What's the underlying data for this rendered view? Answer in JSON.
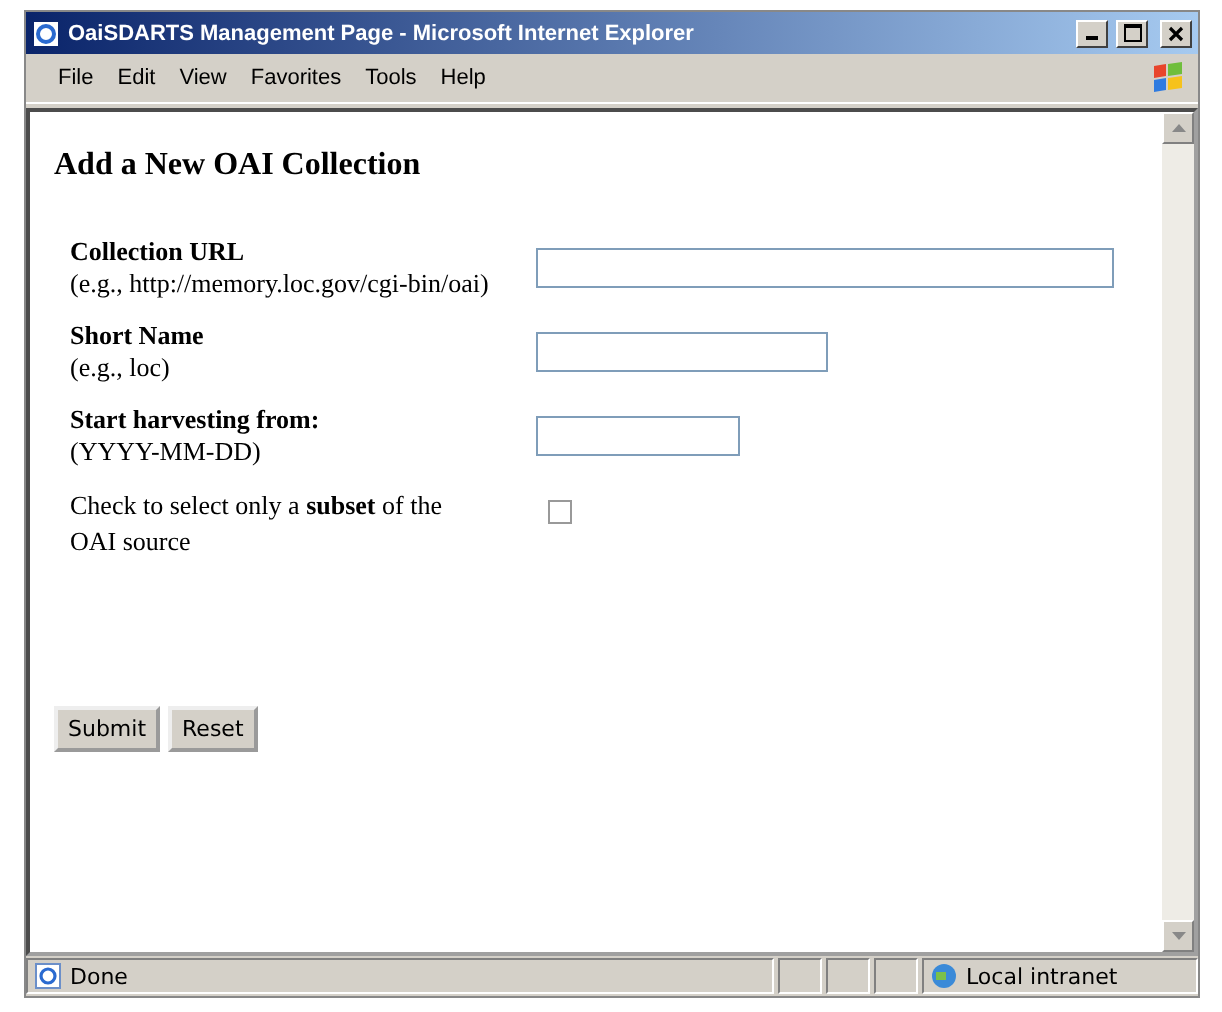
{
  "window": {
    "title": "OaiSDARTS Management Page - Microsoft Internet Explorer"
  },
  "menu": [
    "File",
    "Edit",
    "View",
    "Favorites",
    "Tools",
    "Help"
  ],
  "page": {
    "heading": "Add a New OAI Collection",
    "fields": [
      {
        "kind": "text",
        "label": "Collection URL",
        "hint": " (e.g., http://memory.loc.gov/cgi-bin/oai)"
      },
      {
        "kind": "text",
        "label": "Short Name",
        "hint": "(e.g., loc)"
      },
      {
        "kind": "text",
        "label": "Start harvesting from:",
        "hint": "(YYYY-MM-DD)"
      },
      {
        "kind": "checkbox",
        "label": "Check to select only a **subset** of the OAI source",
        "checked": false
      }
    ],
    "buttons": [
      "Submit",
      "Reset"
    ]
  },
  "status_bar": {
    "text": "Done",
    "zone": "Local intranet"
  }
}
